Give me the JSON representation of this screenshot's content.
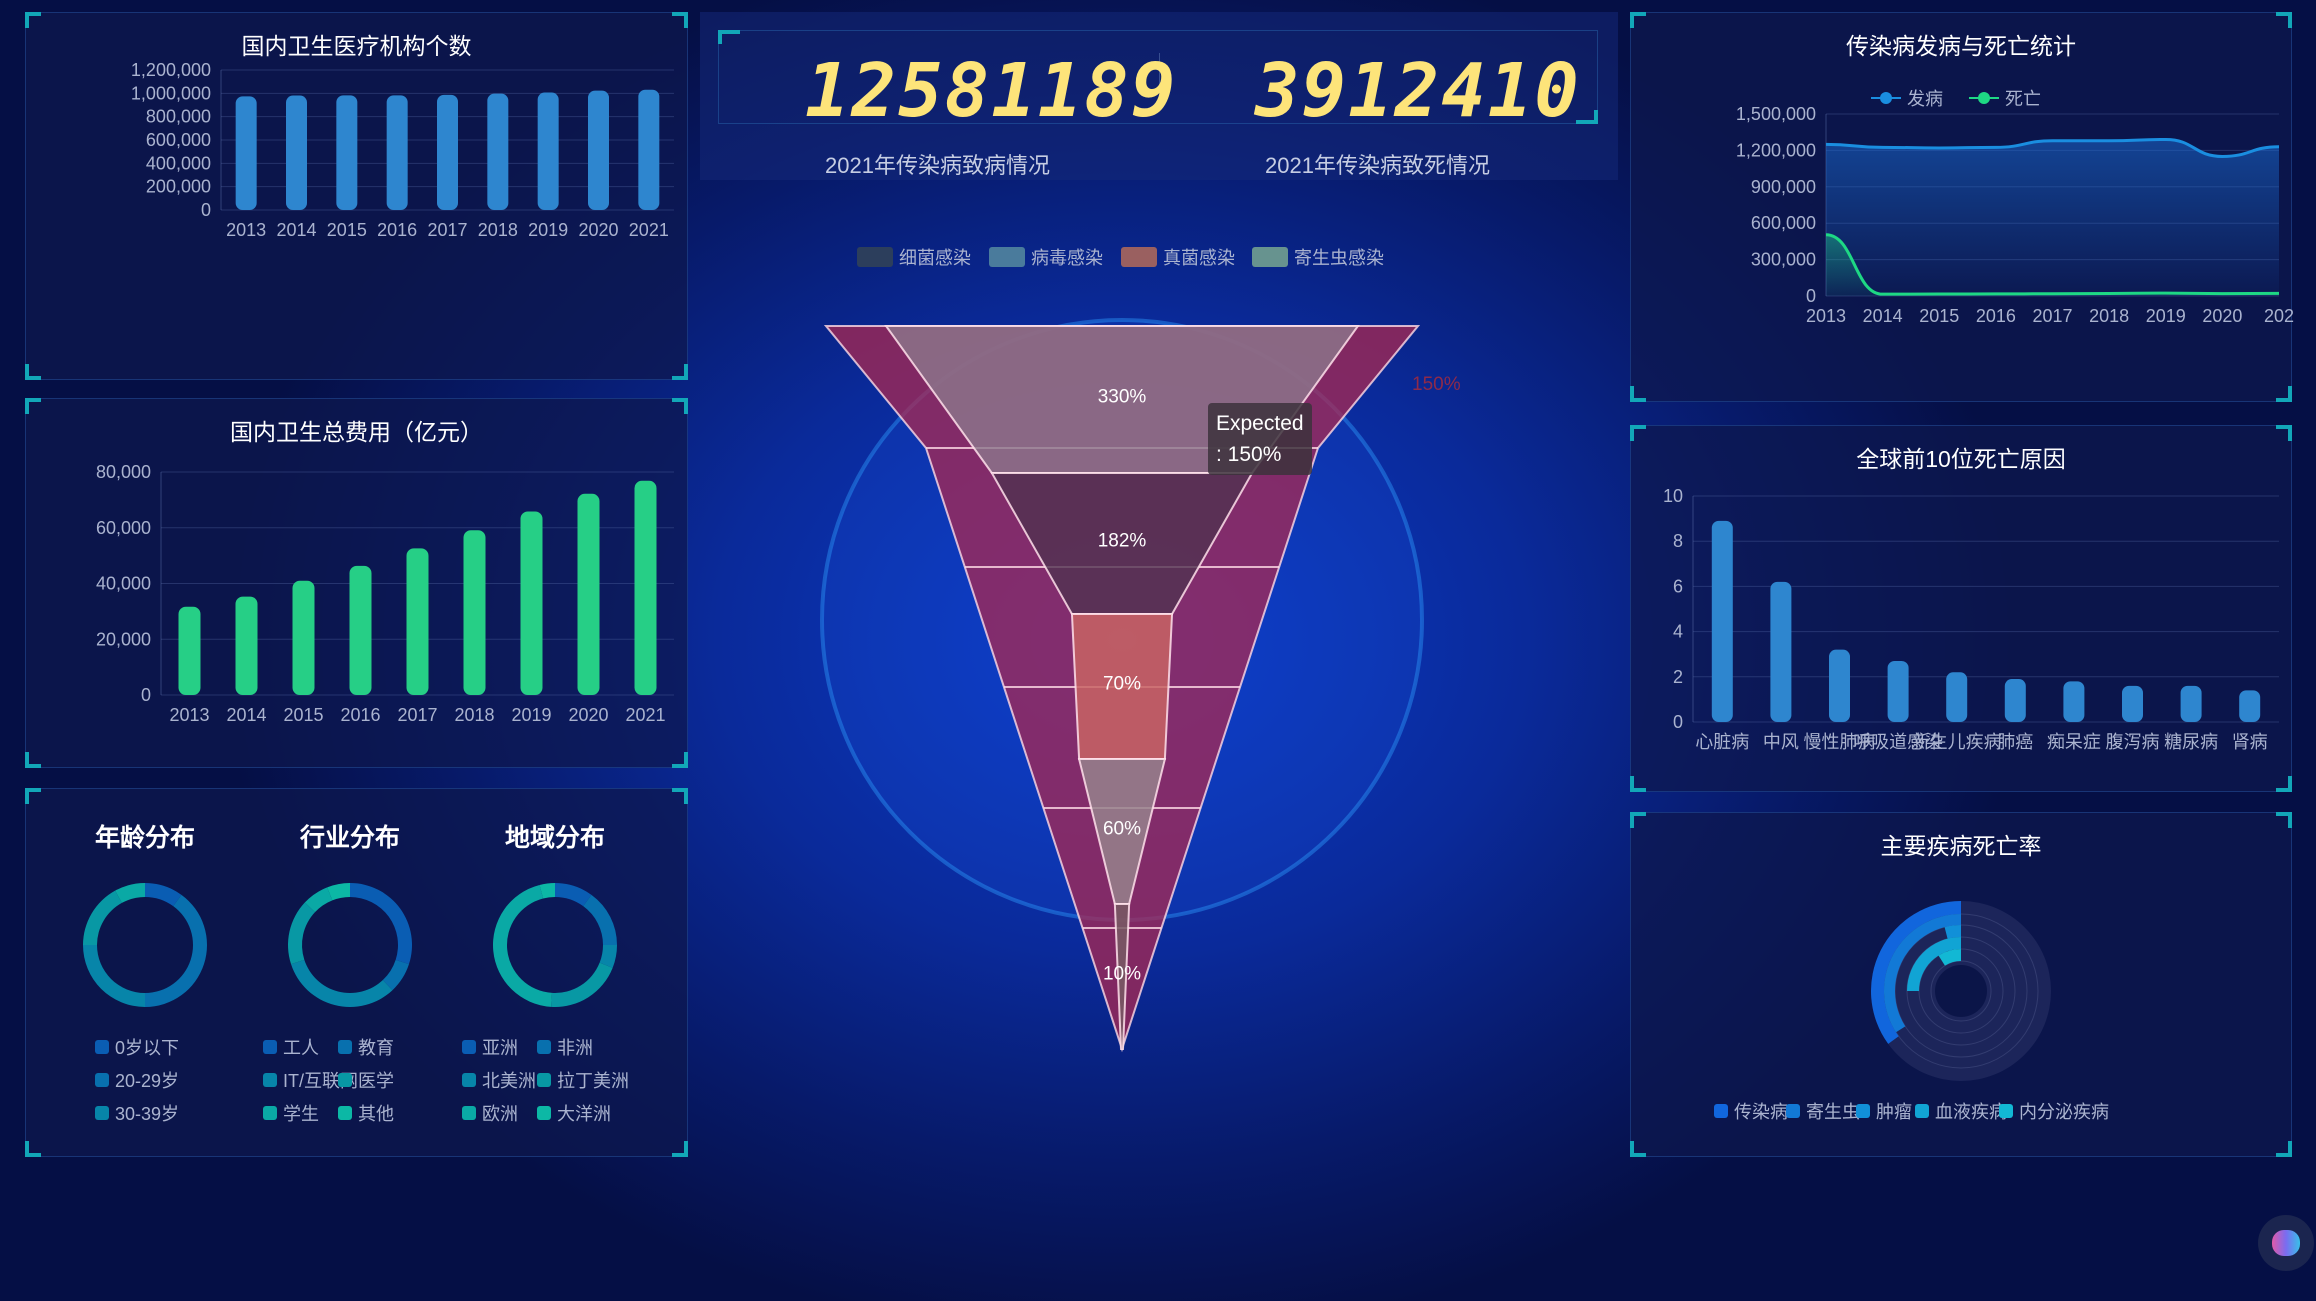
{
  "counters": {
    "infections": "12581189",
    "infections_label": "2021年传染病致病情况",
    "deaths": "3912410",
    "deaths_label": "2021年传染病致死情况",
    "digit_color": "#fde47a"
  },
  "colors": {
    "bar_blue": "#2e86cf",
    "bar_green": "#26cf86",
    "line_incidence": "#1a8ee0",
    "line_death": "#1ed884",
    "corner": "#12a7b8"
  },
  "chart_data": [
    {
      "id": "institutions",
      "type": "bar",
      "title": "国内卫生医疗机构个数",
      "categories": [
        "2013",
        "2014",
        "2015",
        "2016",
        "2017",
        "2018",
        "2019",
        "2020",
        "2021"
      ],
      "values": [
        974000,
        981000,
        983000,
        983000,
        987000,
        997000,
        1007000,
        1023000,
        1031000
      ],
      "ylim": [
        0,
        1200000
      ],
      "yticks": [
        "0",
        "200,000",
        "400,000",
        "600,000",
        "800,000",
        "1,000,000",
        "1,200,000"
      ]
    },
    {
      "id": "expenditure",
      "type": "bar",
      "title": "国内卫生总费用（亿元）",
      "categories": [
        "2013",
        "2014",
        "2015",
        "2016",
        "2017",
        "2018",
        "2019",
        "2020",
        "2021"
      ],
      "values": [
        31669,
        35312,
        40975,
        46345,
        52598,
        59122,
        65841,
        72175,
        76845
      ],
      "ylim": [
        0,
        80000
      ],
      "yticks": [
        "0",
        "20,000",
        "40,000",
        "60,000",
        "80,000"
      ]
    },
    {
      "id": "infectious",
      "type": "line",
      "title": "传染病发病与死亡统计",
      "categories": [
        "2013",
        "2014",
        "2015",
        "2016",
        "2017",
        "2018",
        "2019",
        "2020",
        "202"
      ],
      "series": [
        {
          "name": "发病",
          "values": [
            1250000,
            1225000,
            1220000,
            1225000,
            1280000,
            1280000,
            1290000,
            1150000,
            1230000
          ]
        },
        {
          "name": "死亡",
          "values": [
            505000,
            15000,
            16000,
            17000,
            19000,
            21000,
            24000,
            20000,
            22000
          ]
        }
      ],
      "ylim": [
        0,
        1500000
      ],
      "yticks": [
        "0",
        "300,000",
        "600,000",
        "900,000",
        "1,200,000",
        "1,500,000"
      ]
    },
    {
      "id": "top10",
      "type": "bar",
      "title": "全球前10位死亡原因",
      "categories": [
        "心脏病",
        "中风",
        "慢性肺病",
        "呼吸道感染",
        "新生儿疾病",
        "肺癌",
        "痴呆症",
        "腹泻病",
        "糖尿病",
        "肾病"
      ],
      "values": [
        8.9,
        6.2,
        3.2,
        2.7,
        2.2,
        1.9,
        1.8,
        1.6,
        1.6,
        1.4
      ],
      "ylim": [
        0,
        10
      ],
      "yticks": [
        "0",
        "2",
        "4",
        "6",
        "8",
        "10"
      ]
    },
    {
      "id": "funnel",
      "type": "funnel",
      "legend": [
        "细菌感染",
        "病毒感染",
        "真菌感染",
        "寄生虫感染"
      ],
      "legend_colors": [
        "#2c3e5c",
        "#4a7b9c",
        "#9a6060",
        "#67938f"
      ],
      "actual": [
        330,
        182,
        70,
        60,
        10
      ],
      "actual_labels": [
        "330%",
        "182%",
        "70%",
        "60%",
        "10%"
      ],
      "expected_label": "150%",
      "tooltip": {
        "line1": "Expected",
        "line2": ": 150%"
      }
    },
    {
      "id": "age",
      "type": "pie",
      "title": "年龄分布",
      "legend": [
        "0岁以下",
        "20-29岁",
        "30-39岁"
      ],
      "values": [
        10,
        40,
        25,
        17,
        8
      ]
    },
    {
      "id": "industry",
      "type": "pie",
      "title": "行业分布",
      "legend": [
        "工人",
        "教育",
        "IT/互联网",
        "医学",
        "学生",
        "其他"
      ],
      "values": [
        30,
        8,
        32,
        17,
        7,
        6
      ]
    },
    {
      "id": "region",
      "type": "pie",
      "title": "地域分布",
      "legend": [
        "亚洲",
        "非洲",
        "北美洲",
        "拉丁美洲",
        "欧洲",
        "大洋洲"
      ],
      "values": [
        10,
        15,
        6,
        20,
        45,
        4
      ]
    },
    {
      "id": "mortality",
      "type": "radial-bar",
      "title": "主要疾病死亡率",
      "legend": [
        "传染病",
        "寄生虫",
        "肿瘤",
        "血液疾病",
        "内分泌疾病"
      ],
      "values": [
        0.35,
        0.34,
        0.04,
        0.25,
        0.09
      ],
      "colors": [
        "#1166dd",
        "#1279d6",
        "#1190d8",
        "#11a4d4",
        "#12b8d4"
      ]
    }
  ],
  "donut_colors": [
    "#0a5db3",
    "#0870ae",
    "#0785a9",
    "#0898a4",
    "#0aa9a5",
    "#0cb8a5"
  ]
}
